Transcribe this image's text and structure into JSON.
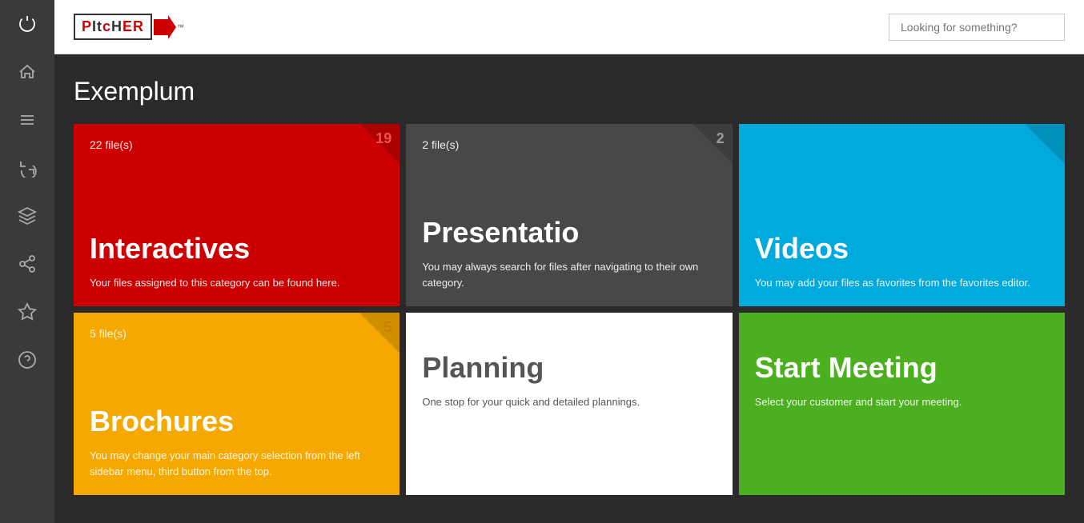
{
  "app": {
    "title": "PItcHER",
    "logo_text": "PITCHER",
    "trademark": "™"
  },
  "header": {
    "search_placeholder": "Looking for something?"
  },
  "sidebar": {
    "items": [
      {
        "name": "power",
        "icon": "power"
      },
      {
        "name": "home",
        "icon": "home"
      },
      {
        "name": "list",
        "icon": "list"
      },
      {
        "name": "refresh",
        "icon": "refresh"
      },
      {
        "name": "layers",
        "icon": "layers"
      },
      {
        "name": "share",
        "icon": "share"
      },
      {
        "name": "star",
        "icon": "star"
      },
      {
        "name": "help",
        "icon": "help"
      }
    ]
  },
  "page": {
    "title": "Exemplum"
  },
  "cards": [
    {
      "id": "interactives",
      "color": "red",
      "files": "22 file(s)",
      "badge": "19",
      "title": "Interactives",
      "desc": "Your files assigned to this category can be found here."
    },
    {
      "id": "presentations",
      "color": "dark",
      "files": "2 file(s)",
      "badge": "2",
      "title": "Presentatio",
      "desc": "You may always search for files after navigating to their own category."
    },
    {
      "id": "videos",
      "color": "blue",
      "files": "",
      "badge": "",
      "title": "Videos",
      "desc": "You may add your files as favorites from the favorites editor."
    },
    {
      "id": "brochures",
      "color": "orange",
      "files": "5 file(s)",
      "badge": "5",
      "title": "Brochures",
      "desc": "You may change your main category selection from the left sidebar menu, third button from the top."
    },
    {
      "id": "planning",
      "color": "white",
      "files": "",
      "badge": "",
      "title": "Planning",
      "desc": "One stop for your quick and detailed plannings."
    },
    {
      "id": "start-meeting",
      "color": "green",
      "files": "",
      "badge": "",
      "title": "Start Meeting",
      "desc": "Select your customer and start your meeting."
    }
  ]
}
